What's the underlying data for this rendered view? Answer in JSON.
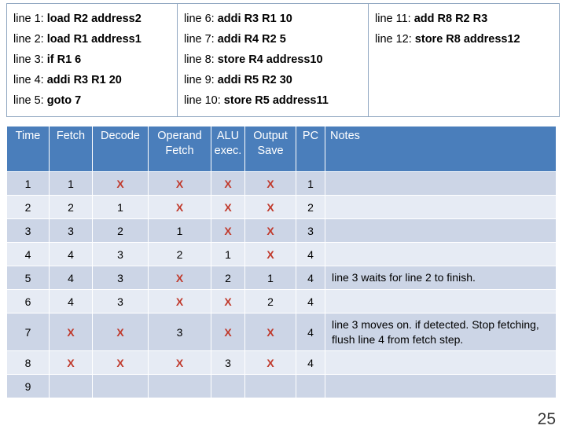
{
  "code_listing": {
    "columns": [
      [
        {
          "label": "line 1:",
          "instruction": "load R2 address2"
        },
        {
          "label": "line 2:",
          "instruction": "load R1 address1"
        },
        {
          "label": "line 3:",
          "instruction": "if R1 6"
        },
        {
          "label": "line 4:",
          "instruction": "addi R3 R1 20"
        },
        {
          "label": "line 5:",
          "instruction": "goto 7"
        }
      ],
      [
        {
          "label": "line 6:",
          "instruction": "addi R3 R1 10"
        },
        {
          "label": "line 7:",
          "instruction": "addi R4 R2 5"
        },
        {
          "label": "line 8:",
          "instruction": "store R4 address10"
        },
        {
          "label": "line 9:",
          "instruction": "addi R5 R2 30"
        },
        {
          "label": "line 10:",
          "instruction": "store R5 address11"
        }
      ],
      [
        {
          "label": "line 11:",
          "instruction": "add R8 R2 R3"
        },
        {
          "label": "line 12:",
          "instruction": "store R8 address12"
        }
      ]
    ]
  },
  "table": {
    "headers": [
      "Time",
      "Fetch",
      "Decode",
      "Operand Fetch",
      "ALU exec.",
      "Output Save",
      "PC",
      "Notes"
    ],
    "rows": [
      {
        "time": "1",
        "fetch": "1",
        "decode": "X",
        "operand": "X",
        "alu": "X",
        "output": "X",
        "pc": "1",
        "notes": ""
      },
      {
        "time": "2",
        "fetch": "2",
        "decode": "1",
        "operand": "X",
        "alu": "X",
        "output": "X",
        "pc": "2",
        "notes": ""
      },
      {
        "time": "3",
        "fetch": "3",
        "decode": "2",
        "operand": "1",
        "alu": "X",
        "output": "X",
        "pc": "3",
        "notes": ""
      },
      {
        "time": "4",
        "fetch": "4",
        "decode": "3",
        "operand": "2",
        "alu": "1",
        "output": "X",
        "pc": "4",
        "notes": ""
      },
      {
        "time": "5",
        "fetch": "4",
        "decode": "3",
        "operand": "X",
        "alu": "2",
        "output": "1",
        "pc": "4",
        "notes": "line 3 waits for line 2 to finish."
      },
      {
        "time": "6",
        "fetch": "4",
        "decode": "3",
        "operand": "X",
        "alu": "X",
        "output": "2",
        "pc": "4",
        "notes": ""
      },
      {
        "time": "7",
        "fetch": "X",
        "decode": "X",
        "operand": "3",
        "alu": "X",
        "output": "X",
        "pc": "4",
        "notes": "line 3 moves on. if detected. Stop fetching, flush line 4 from fetch step."
      },
      {
        "time": "8",
        "fetch": "X",
        "decode": "X",
        "operand": "X",
        "alu": "3",
        "output": "X",
        "pc": "4",
        "notes": ""
      },
      {
        "time": "9",
        "fetch": "",
        "decode": "",
        "operand": "",
        "alu": "",
        "output": "",
        "pc": "",
        "notes": ""
      }
    ]
  },
  "page_number": "25",
  "colors": {
    "header_blue": "#4a7ebb",
    "row_dark": "#ccd5e6",
    "row_light": "#e6ebf4",
    "x_marker": "#c0392b",
    "code_border": "#8fa6c0"
  }
}
